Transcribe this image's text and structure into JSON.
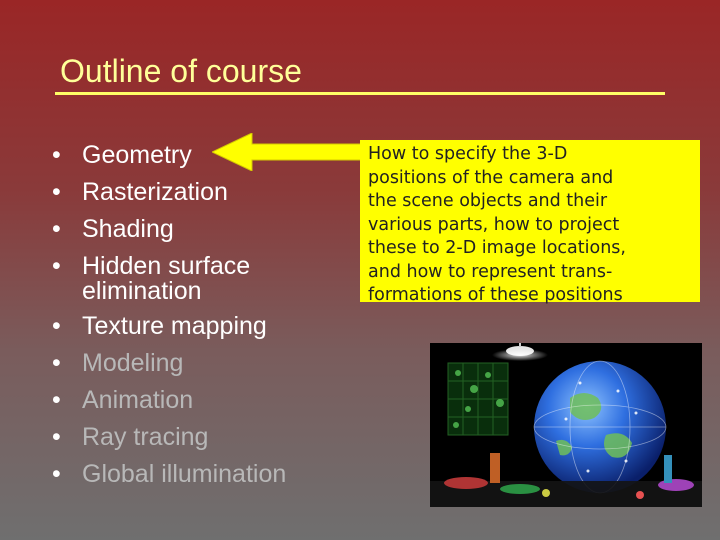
{
  "slide": {
    "title": "Outline of course",
    "bullet_glyph": "•",
    "bullets": [
      {
        "text": "Geometry",
        "state": "active"
      },
      {
        "text": "Rasterization",
        "state": "active"
      },
      {
        "text": "Shading",
        "state": "active"
      },
      {
        "text": "Hidden surface",
        "continuation": "elimination",
        "state": "active"
      },
      {
        "text": "Texture mapping",
        "state": "active"
      },
      {
        "text": "Modeling",
        "state": "dimmed"
      },
      {
        "text": "Animation",
        "state": "dimmed"
      },
      {
        "text": "Ray tracing",
        "state": "dimmed"
      },
      {
        "text": "Global illumination",
        "state": "dimmed"
      }
    ],
    "callout": {
      "line1": "How to specify the 3-D",
      "line2": "positions of the camera and",
      "line3": "the scene objects and their",
      "line4": "various parts, how to project",
      "line5": "these to 2-D image locations,",
      "line6": "and how to represent trans-",
      "line7": "formations of these positions"
    },
    "arrow_icon": "left-arrow-icon",
    "image_icon": "globe-scene-image"
  },
  "colors": {
    "title": "#ffff99",
    "rule": "#ffff66",
    "active_text": "#ffffff",
    "dimmed_text": "#b8b8b8",
    "callout_bg": "#ffff00",
    "arrow": "#ffff00"
  }
}
